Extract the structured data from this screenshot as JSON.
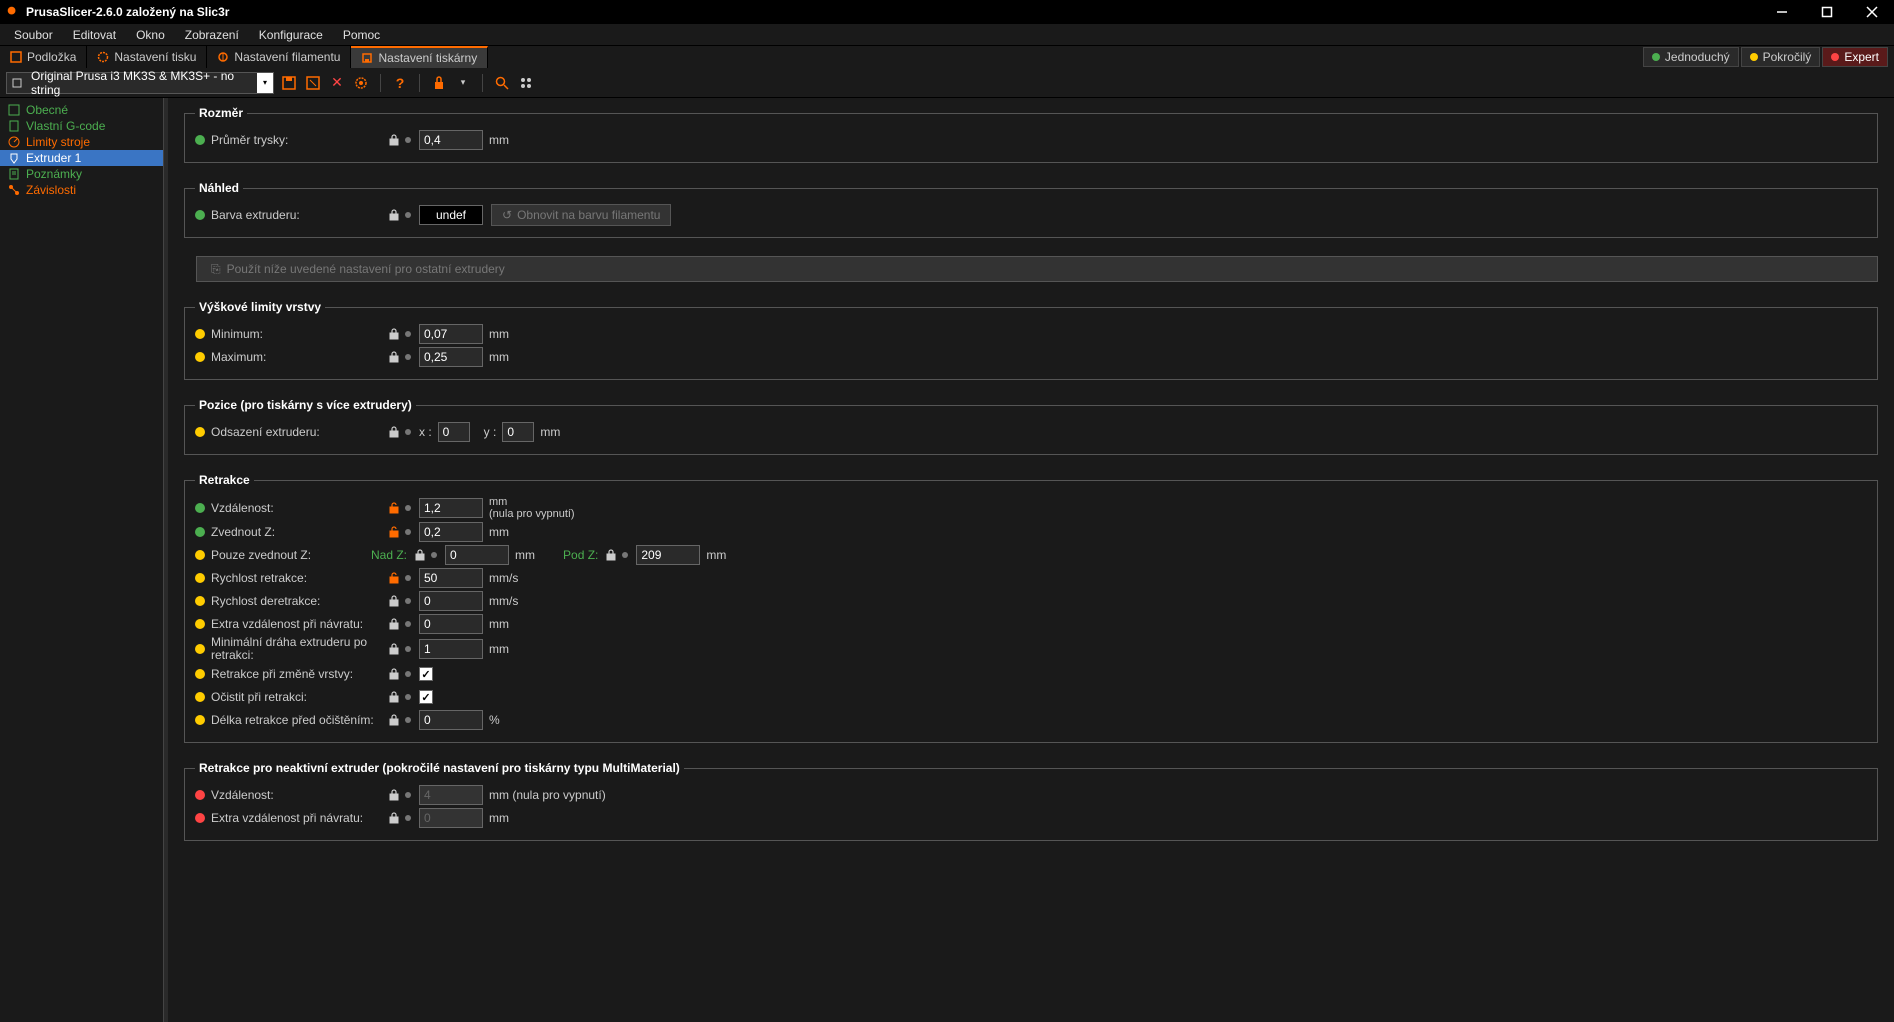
{
  "title": "PrusaSlicer-2.6.0 založený na Slic3r",
  "menu": [
    "Soubor",
    "Editovat",
    "Okno",
    "Zobrazení",
    "Konfigurace",
    "Pomoc"
  ],
  "tabs": [
    {
      "label": "Podložka"
    },
    {
      "label": "Nastavení tisku"
    },
    {
      "label": "Nastavení filamentu"
    },
    {
      "label": "Nastavení tiskárny"
    }
  ],
  "modes": {
    "simple": "Jednoduchý",
    "advanced": "Pokročilý",
    "expert": "Expert"
  },
  "preset": "Original Prusa i3 MK3S & MK3S+ - no string",
  "sidebar": [
    {
      "label": "Obecné"
    },
    {
      "label": "Vlastní G-code"
    },
    {
      "label": "Limity stroje"
    },
    {
      "label": "Extruder 1"
    },
    {
      "label": "Poznámky"
    },
    {
      "label": "Závislosti"
    }
  ],
  "groups": {
    "rozmer": {
      "legend": "Rozměr",
      "prumer_label": "Průměr trysky:",
      "prumer_value": "0,4",
      "prumer_unit": "mm"
    },
    "nahled": {
      "legend": "Náhled",
      "barva_label": "Barva extruderu:",
      "barva_value": "undef",
      "reset_label": "Obnovit na barvu filamentu"
    },
    "apply_label": "Použít níže uvedené nastavení pro ostatní extrudery",
    "vyskove": {
      "legend": "Výškové limity vrstvy",
      "min_label": "Minimum:",
      "min_value": "0,07",
      "max_label": "Maximum:",
      "max_value": "0,25",
      "unit": "mm"
    },
    "pozice": {
      "legend": "Pozice (pro tiskárny s více extrudery)",
      "offset_label": "Odsazení extruderu:",
      "x_label": "x :",
      "x_value": "0",
      "y_label": "y :",
      "y_value": "0",
      "unit": "mm"
    },
    "retrakce": {
      "legend": "Retrakce",
      "vzdalenost_label": "Vzdálenost:",
      "vzdalenost_value": "1,2",
      "vzdalenost_unit1": "mm",
      "vzdalenost_unit2": "(nula pro vypnutí)",
      "zvednout_label": "Zvednout Z:",
      "zvednout_value": "0,2",
      "zvednout_unit": "mm",
      "pouze_label": "Pouze zvednout Z:",
      "nadz_label": "Nad Z:",
      "nadz_value": "0",
      "nadz_unit": "mm",
      "podz_label": "Pod Z:",
      "podz_value": "209",
      "podz_unit": "mm",
      "rychlost_r_label": "Rychlost retrakce:",
      "rychlost_r_value": "50",
      "rychlost_r_unit": "mm/s",
      "rychlost_d_label": "Rychlost deretrakce:",
      "rychlost_d_value": "0",
      "rychlost_d_unit": "mm/s",
      "extra_label": "Extra vzdálenost při návratu:",
      "extra_value": "0",
      "extra_unit": "mm",
      "mindra_label": "Minimální dráha extruderu po retrakci:",
      "mindra_value": "1",
      "mindra_unit": "mm",
      "retrzm_label": "Retrakce při změně vrstvy:",
      "ocistit_label": "Očistit při retrakci:",
      "delka_label": "Délka retrakce před očištěním:",
      "delka_value": "0",
      "delka_unit": "%"
    },
    "retrakce2": {
      "legend": "Retrakce pro neaktivní extruder (pokročilé nastavení pro tiskárny typu MultiMaterial)",
      "vzdalenost_label": "Vzdálenost:",
      "vzdalenost_value": "4",
      "vzdalenost_unit": "mm (nula pro vypnutí)",
      "extra_label": "Extra vzdálenost při návratu:",
      "extra_value": "0",
      "extra_unit": "mm"
    }
  }
}
